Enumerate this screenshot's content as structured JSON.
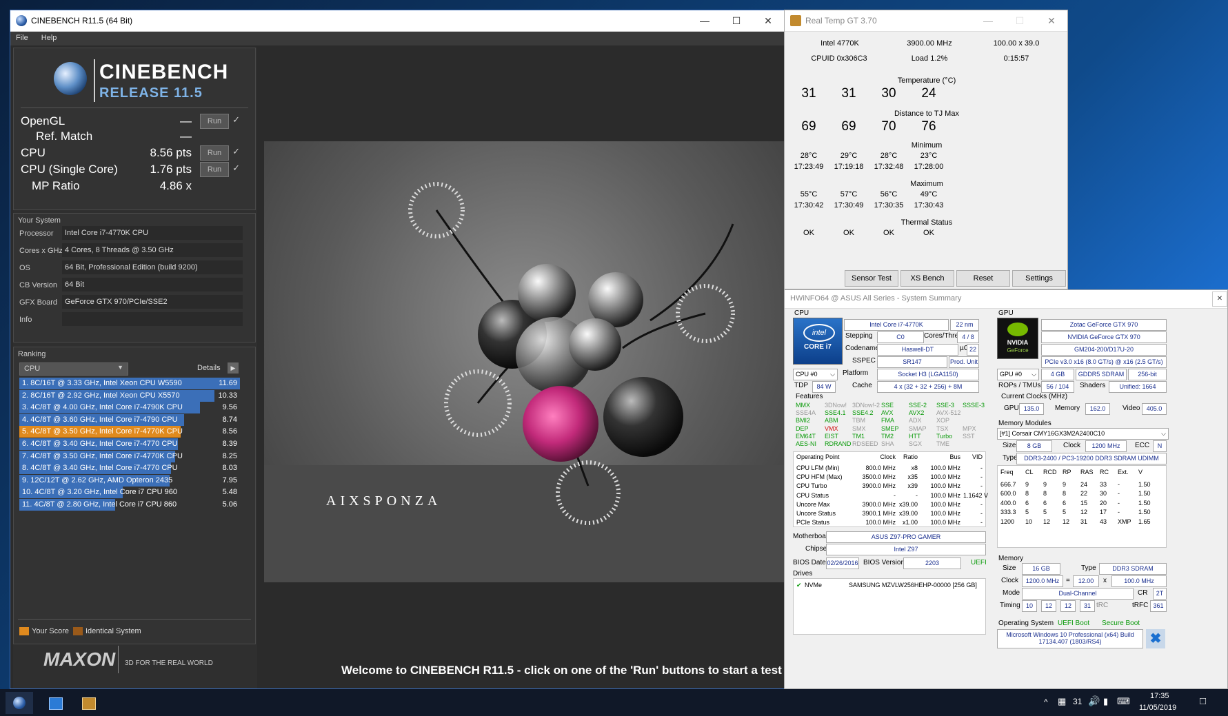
{
  "cinebench": {
    "title": "CINEBENCH R11.5 (64 Bit)",
    "menu": [
      "File",
      "Help"
    ],
    "logo_title": "CINEBENCH",
    "logo_release": "RELEASE 11.5",
    "tests": [
      {
        "label": "OpenGL",
        "value": "—",
        "run": "Run",
        "check": "✓"
      },
      {
        "label": "Ref. Match",
        "value": "—",
        "run": "",
        "check": ""
      },
      {
        "label": "CPU",
        "value": "8.56 pts",
        "run": "Run",
        "check": "✓"
      },
      {
        "label": "CPU (Single Core)",
        "value": "1.76 pts",
        "run": "Run",
        "check": "✓"
      },
      {
        "label": "MP Ratio",
        "value": "4.86 x",
        "run": "",
        "check": ""
      }
    ],
    "your_system_label": "Your System",
    "system": [
      {
        "k": "Processor",
        "v": "Intel Core i7-4770K CPU"
      },
      {
        "k": "Cores x GHz",
        "v": "4 Cores, 8 Threads @ 3.50 GHz"
      },
      {
        "k": "OS",
        "v": "64 Bit, Professional Edition (build 9200)"
      },
      {
        "k": "CB Version",
        "v": "64 Bit"
      },
      {
        "k": "GFX Board",
        "v": "GeForce GTX 970/PCIe/SSE2"
      },
      {
        "k": "Info",
        "v": ""
      }
    ],
    "ranking_label": "Ranking",
    "ranking_dropdown": "CPU",
    "details_label": "Details",
    "ranking": [
      {
        "text": "1. 8C/16T @ 3.33 GHz, Intel Xeon CPU W5590",
        "score": "11.69",
        "fill": 1.0,
        "color": "#3b6fb8"
      },
      {
        "text": "2. 8C/16T @ 2.92 GHz, Intel Xeon CPU X5570",
        "score": "10.33",
        "fill": 0.884,
        "color": "#3b6fb8"
      },
      {
        "text": "3. 4C/8T @ 4.00 GHz, Intel Core i7-4790K CPU",
        "score": "9.56",
        "fill": 0.818,
        "color": "#3b6fb8"
      },
      {
        "text": "4. 4C/8T @ 3.60 GHz, Intel Core i7-4790 CPU",
        "score": "8.74",
        "fill": 0.748,
        "color": "#3b6fb8"
      },
      {
        "text": "5. 4C/8T @ 3.50 GHz, Intel Core i7-4770K CPU",
        "score": "8.56",
        "fill": 0.732,
        "color": "#e08a1e"
      },
      {
        "text": "6. 4C/8T @ 3.40 GHz, Intel Core i7-4770 CPU",
        "score": "8.39",
        "fill": 0.718,
        "color": "#3b6fb8"
      },
      {
        "text": "7. 4C/8T @ 3.50 GHz, Intel Core i7-4770K CPU",
        "score": "8.25",
        "fill": 0.706,
        "color": "#3b6fb8"
      },
      {
        "text": "8. 4C/8T @ 3.40 GHz, Intel Core i7-4770 CPU",
        "score": "8.03",
        "fill": 0.687,
        "color": "#3b6fb8"
      },
      {
        "text": "9. 12C/12T @ 2.62 GHz, AMD Opteron 2435",
        "score": "7.95",
        "fill": 0.68,
        "color": "#3b6fb8"
      },
      {
        "text": "10. 4C/8T @ 3.20 GHz, Intel Core i7 CPU 960",
        "score": "5.48",
        "fill": 0.469,
        "color": "#3b6fb8"
      },
      {
        "text": "11. 4C/8T @ 2.80 GHz, Intel Core i7 CPU 860",
        "score": "5.06",
        "fill": 0.433,
        "color": "#3b6fb8"
      }
    ],
    "legend_your_score": "Your Score",
    "legend_identical": "Identical System",
    "maxon": "MAXON",
    "maxon_tag": "3D FOR THE REAL WORLD",
    "scene_brand": "AIXSPONZA",
    "welcome": "Welcome to CINEBENCH R11.5 - click on one of the 'Run' buttons to start a test"
  },
  "realtemp": {
    "title": "Real Temp GT 3.70",
    "cpu": "Intel 4770K",
    "mhz": "3900.00 MHz",
    "multiplier": "100.00 x 39.0",
    "cpuid": "CPUID  0x306C3",
    "load": "Load   1.2%",
    "uptime": "0:15:57",
    "temp_label": "Temperature (°C)",
    "temps": [
      "31",
      "31",
      "30",
      "24"
    ],
    "tj_label": "Distance to TJ Max",
    "tj": [
      "69",
      "69",
      "70",
      "76"
    ],
    "min_label": "Minimum",
    "min_temps": [
      "28°C",
      "29°C",
      "28°C",
      "23°C"
    ],
    "min_times": [
      "17:23:49",
      "17:19:18",
      "17:32:48",
      "17:28:00"
    ],
    "max_label": "Maximum",
    "max_temps": [
      "55°C",
      "57°C",
      "56°C",
      "49°C"
    ],
    "max_times": [
      "17:30:42",
      "17:30:49",
      "17:30:35",
      "17:30:43"
    ],
    "thermal_label": "Thermal Status",
    "thermal": [
      "OK",
      "OK",
      "OK",
      "OK"
    ],
    "buttons": [
      "Sensor Test",
      "XS Bench",
      "Reset",
      "Settings"
    ]
  },
  "hwinfo": {
    "title": "HWiNFO64 @ ASUS All Series - System Summary",
    "cpu_label": "CPU",
    "cpu_name": "Intel Core i7-4770K",
    "nm": "22 nm",
    "stepping_label": "Stepping",
    "stepping": "C0",
    "cores_label": "Cores/Threads",
    "cores": "4 / 8",
    "codename_label": "Codename",
    "codename": "Haswell-DT",
    "ucu_label": "µCU",
    "ucu": "22",
    "sspec_label": "SSPEC",
    "sspec": "SR147",
    "prod_unit": "Prod. Unit",
    "cpu_select": "CPU #0",
    "platform_label": "Platform",
    "platform": "Socket H3 (LGA1150)",
    "tdp_label": "TDP",
    "tdp": "84 W",
    "cache_label": "Cache",
    "cache": "4 x (32 + 32 + 256) + 8M",
    "features_label": "Features",
    "features": [
      [
        "MMX",
        "3DNow!",
        "3DNow!-2",
        "SSE",
        "SSE-2",
        "SSE-3",
        "SSSE-3"
      ],
      [
        "SSE4A",
        "SSE4.1",
        "SSE4.2",
        "AVX",
        "AVX2",
        "AVX-512",
        ""
      ],
      [
        "BMI2",
        "ABM",
        "TBM",
        "FMA",
        "ADX",
        "XOP",
        ""
      ],
      [
        "DEP",
        "VMX",
        "SMX",
        "SMEP",
        "SMAP",
        "TSX",
        "MPX"
      ],
      [
        "EM64T",
        "EIST",
        "TM1",
        "TM2",
        "HTT",
        "Turbo",
        "SST"
      ],
      [
        "AES-NI",
        "RDRAND",
        "RDSEED",
        "SHA",
        "SGX",
        "TME",
        ""
      ]
    ],
    "op_headers": [
      "Operating Point",
      "Clock",
      "Ratio",
      "Bus",
      "VID"
    ],
    "op_rows": [
      [
        "CPU LFM (Min)",
        "800.0 MHz",
        "x8",
        "100.0 MHz",
        "-"
      ],
      [
        "CPU HFM (Max)",
        "3500.0 MHz",
        "x35",
        "100.0 MHz",
        "-"
      ],
      [
        "CPU Turbo",
        "3900.0 MHz",
        "x39",
        "100.0 MHz",
        "-"
      ],
      [
        "CPU Status",
        "-",
        "-",
        "100.0 MHz",
        "1.1642 V"
      ],
      [
        "Uncore Max",
        "3900.0 MHz",
        "x39.00",
        "100.0 MHz",
        "-"
      ],
      [
        "Uncore Status",
        "3900.1 MHz",
        "x39.00",
        "100.0 MHz",
        "-"
      ],
      [
        "PCIe Status",
        "100.0 MHz",
        "x1.00",
        "100.0 MHz",
        "-"
      ]
    ],
    "mobo_label": "Motherboard",
    "mobo": "ASUS Z97-PRO GAMER",
    "chipset_label": "Chipset",
    "chipset": "Intel Z97",
    "bios_date_label": "BIOS Date",
    "bios_date": "02/26/2016",
    "bios_ver_label": "BIOS Version",
    "bios_ver": "2203",
    "uefi": "UEFI",
    "drives_label": "Drives",
    "drive_type": "NVMe",
    "drive_name": "SAMSUNG MZVLW256HEHP-00000 [256 GB]",
    "gpu_label": "GPU",
    "gpu_brand": "Zotac GeForce GTX 970",
    "gpu_name": "NVIDIA GeForce GTX 970",
    "gpu_chip": "GM204-200/D17U-20",
    "gpu_pcie": "PCIe v3.0 x16 (8.0 GT/s) @ x16 (2.5 GT/s)",
    "gpu_select": "GPU #0",
    "gpu_mem": "4 GB",
    "gpu_memtype": "GDDR5 SDRAM",
    "gpu_bits": "256-bit",
    "rops_label": "ROPs / TMUs",
    "rops": "56 / 104",
    "shaders_label": "Shaders",
    "shaders": "Unified: 1664",
    "clocks_label": "Current Clocks (MHz)",
    "gpu_clk_label": "GPU",
    "gpu_clk": "135.0",
    "mem_clk_label": "Memory",
    "mem_clk": "162.0",
    "video_clk_label": "Video",
    "video_clk": "405.0",
    "memmod_label": "Memory Modules",
    "memmod": "[#1] Corsair CMY16GX3M2A2400C10",
    "mm_size_label": "Size",
    "mm_size": "8 GB",
    "mm_clock_label": "Clock",
    "mm_clock": "1200 MHz",
    "mm_ecc_label": "ECC",
    "mm_ecc": "N",
    "mm_type_label": "Type",
    "mm_type": "DDR3-2400 / PC3-19200 DDR3 SDRAM UDIMM",
    "timing_headers": [
      "Freq",
      "CL",
      "RCD",
      "RP",
      "RAS",
      "RC",
      "Ext.",
      "V"
    ],
    "timing_rows": [
      [
        "666.7",
        "9",
        "9",
        "9",
        "24",
        "33",
        "-",
        "1.50"
      ],
      [
        "600.0",
        "8",
        "8",
        "8",
        "22",
        "30",
        "-",
        "1.50"
      ],
      [
        "400.0",
        "6",
        "6",
        "6",
        "15",
        "20",
        "-",
        "1.50"
      ],
      [
        "333.3",
        "5",
        "5",
        "5",
        "12",
        "17",
        "-",
        "1.50"
      ],
      [
        "1200",
        "10",
        "12",
        "12",
        "31",
        "43",
        "XMP",
        "1.65"
      ]
    ],
    "memory_label": "Memory",
    "m_size_label": "Size",
    "m_size": "16 GB",
    "m_type_label": "Type",
    "m_type": "DDR3 SDRAM",
    "m_clock_label": "Clock",
    "m_clock": "1200.0 MHz",
    "m_eq": "=",
    "m_mult": "12.00",
    "m_x": "x",
    "m_bus": "100.0 MHz",
    "m_mode_label": "Mode",
    "m_mode": "Dual-Channel",
    "m_cr_label": "CR",
    "m_cr": "2T",
    "m_timing_label": "Timing",
    "m_timing": [
      "10",
      "12",
      "12",
      "31"
    ],
    "m_trc": "tRC",
    "m_trfc_label": "tRFC",
    "m_trfc": "361",
    "os_label": "Operating System",
    "uefi_boot": "UEFI Boot",
    "secure_boot": "Secure Boot",
    "os_name": "Microsoft Windows 10 Professional (x64) Build 17134.407 (1803/RS4)"
  },
  "taskbar": {
    "time": "17:35",
    "date": "11/05/2019",
    "tray_count": "31"
  }
}
